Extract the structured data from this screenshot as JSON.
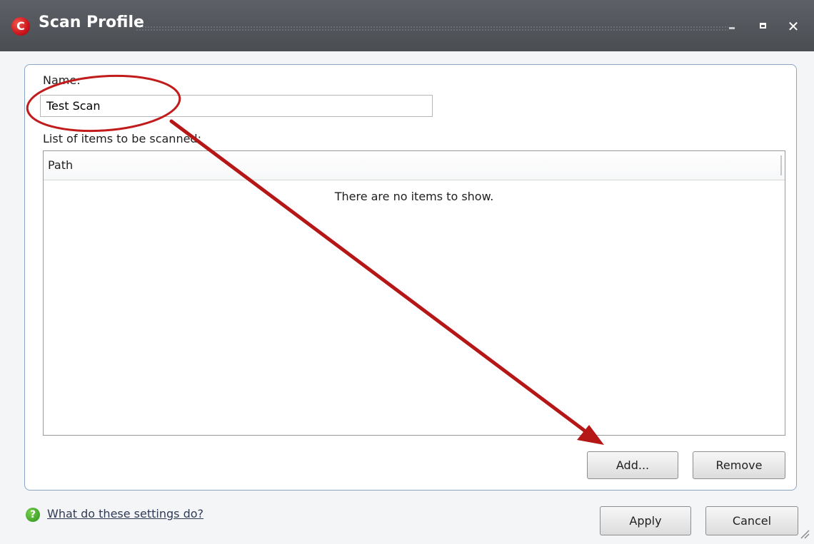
{
  "window": {
    "title": "Scan Profile",
    "app_icon_letter": "C",
    "controls": {
      "minimize": "minimize-icon",
      "maximize": "maximize-icon",
      "close": "close-icon"
    }
  },
  "form": {
    "name_label": "Name:",
    "name_value": "Test Scan",
    "list_label": "List of items to be scanned:",
    "list": {
      "columns": [
        "Path"
      ],
      "empty_message": "There are no items to show."
    },
    "buttons": {
      "add": "Add...",
      "remove": "Remove"
    }
  },
  "footer": {
    "help_icon": "help-icon",
    "help_link": "What do these settings do?",
    "apply": "Apply",
    "cancel": "Cancel"
  },
  "colors": {
    "titlebar": "#4a4e53",
    "annotation_red": "#c11b1b",
    "app_icon_red": "#c8101a",
    "help_green": "#2f8f1c"
  }
}
